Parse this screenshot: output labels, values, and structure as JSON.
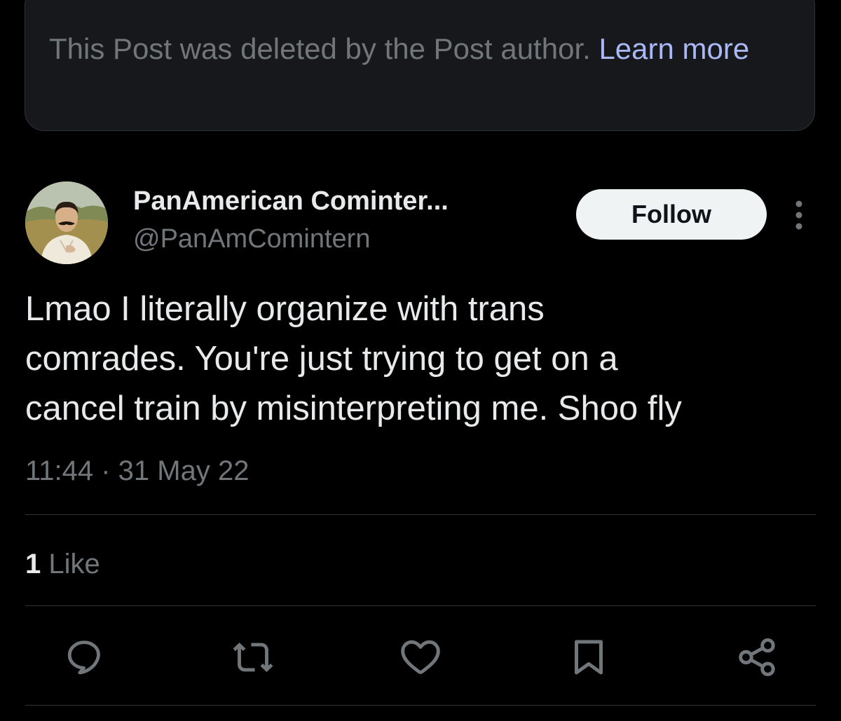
{
  "notice": {
    "text": "This Post was deleted by the Post author.",
    "link_label": "Learn more"
  },
  "author": {
    "display_name": "PanAmerican Cominter...",
    "handle": "@PanAmComintern"
  },
  "follow_button": {
    "label": "Follow"
  },
  "post": {
    "lines": [
      "Lmao I literally organize with trans",
      "comrades. You're just trying to get on a",
      "cancel train by misinterpreting me. Shoo fly"
    ],
    "timestamp": "11:44 · 31 May 22"
  },
  "engagement": {
    "like_count": "1",
    "like_label": "Like"
  },
  "actions": [
    {
      "icon": "reply-icon"
    },
    {
      "icon": "repost-icon"
    },
    {
      "icon": "heart-icon"
    },
    {
      "icon": "bookmark-icon"
    },
    {
      "icon": "share-icon"
    }
  ],
  "colors": {
    "background": "#000000",
    "notice_background": "#16181c",
    "primary_text": "#e7e9ea",
    "secondary_text": "#71767b",
    "link": "#aab8f5",
    "divider": "#2f3336",
    "follow_background": "#eff3f4"
  }
}
